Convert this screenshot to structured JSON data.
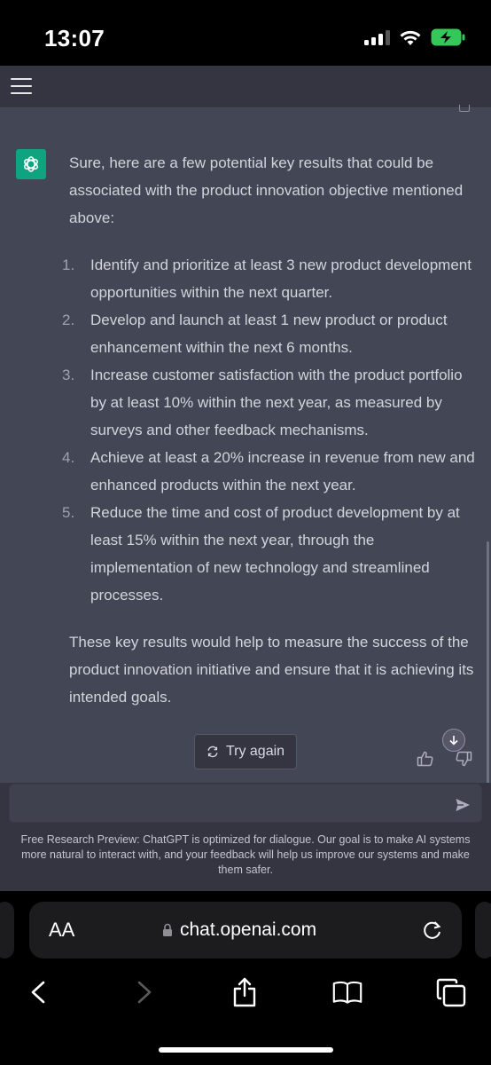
{
  "status_bar": {
    "time": "13:07",
    "icons": [
      "signal-icon",
      "wifi-icon",
      "battery-charging-icon"
    ]
  },
  "header": {
    "menu_icon": "hamburger-menu-icon"
  },
  "message": {
    "avatar_icon": "openai-logo-icon",
    "intro": "Sure, here are a few potential key results that could be associated with the product innovation objective mentioned above:",
    "items": [
      {
        "num": "1.",
        "text": "Identify and prioritize at least 3 new product development opportunities within the next quarter."
      },
      {
        "num": "2.",
        "text": "Develop and launch at least 1 new product or product enhancement within the next 6 months."
      },
      {
        "num": "3.",
        "text": "Increase customer satisfaction with the product portfolio by at least 10% within the next year, as measured by surveys and other feedback mechanisms."
      },
      {
        "num": "4.",
        "text": "Achieve at least a 20% increase in revenue from new and enhanced products within the next year."
      },
      {
        "num": "5.",
        "text": "Reduce the time and cost of product development by at least 15% within the next year, through the implementation of new technology and streamlined processes."
      }
    ],
    "outro": "These key results would help to measure the success of the product innovation initiative and ensure that it is achieving its intended goals."
  },
  "actions": {
    "try_again_label": "Try again",
    "thumbs_up_icon": "thumbs-up-icon",
    "thumbs_down_icon": "thumbs-down-icon",
    "scroll_down_icon": "arrow-down-icon"
  },
  "input": {
    "placeholder": "",
    "send_icon": "send-icon"
  },
  "disclaimer": "Free Research Preview: ChatGPT is optimized for dialogue. Our goal is to make AI systems more natural to interact with, and your feedback will help us improve our systems and make them safer.",
  "browser": {
    "text_size_label": "AA",
    "url": "chat.openai.com",
    "toolbar_icons": [
      "back-icon",
      "forward-icon",
      "share-icon",
      "bookmarks-icon",
      "tabs-icon"
    ]
  },
  "colors": {
    "chat_bg": "#434654",
    "page_bg": "#343541",
    "accent": "#10a37f"
  }
}
